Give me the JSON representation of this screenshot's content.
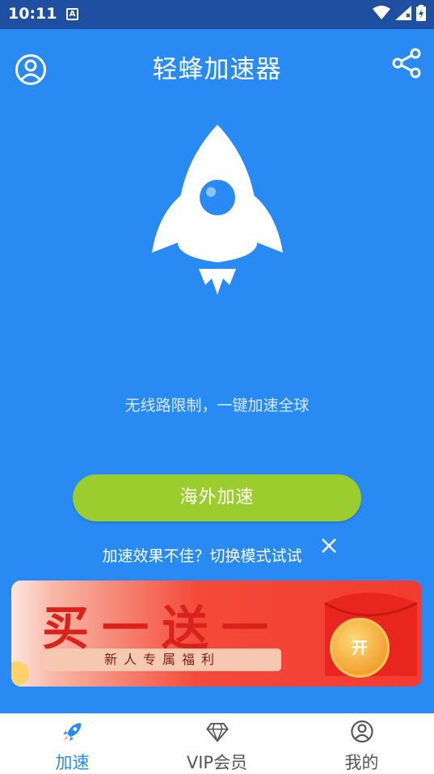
{
  "status_bar": {
    "time": "10:11",
    "notification_letter": "A"
  },
  "header": {
    "title": "轻蜂加速器"
  },
  "main": {
    "tagline": "无线路限制，一键加速全球",
    "boost_button_label": "海外加速",
    "tip_text": "加速效果不佳？切换模式试试"
  },
  "banner": {
    "title": "买一送一",
    "subtitle": "新人专属福利",
    "coin_label": "开"
  },
  "bottom_nav": {
    "items": [
      {
        "label": "加速",
        "icon": "rocket-icon",
        "active": true
      },
      {
        "label": "VIP会员",
        "icon": "diamond-icon",
        "active": false
      },
      {
        "label": "我的",
        "icon": "user-icon",
        "active": false
      }
    ]
  },
  "colors": {
    "primary": "#2a8af3",
    "button": "#9ccd2e",
    "banner_red": "#f23b32"
  }
}
